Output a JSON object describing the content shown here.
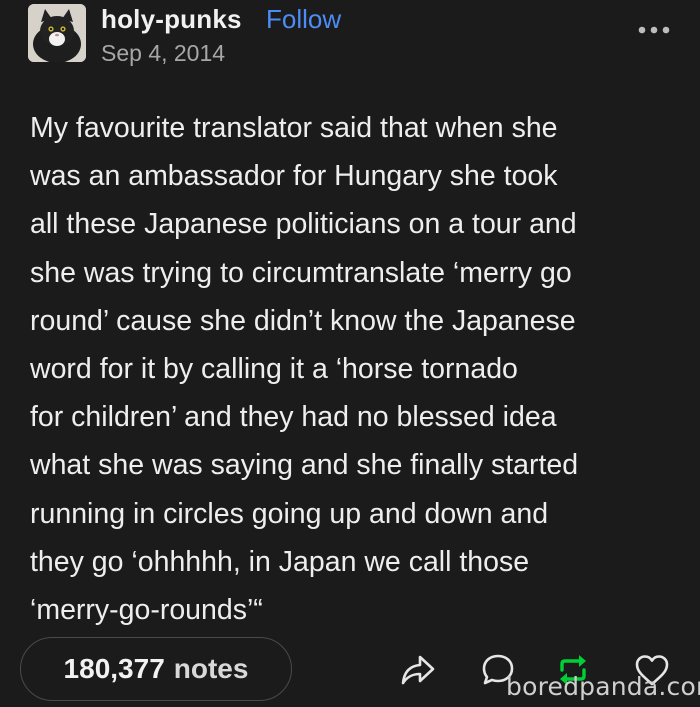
{
  "post": {
    "username": "holy-punks",
    "follow_label": "Follow",
    "date": "Sep 4, 2014",
    "more_icon": "ellipsis-icon",
    "body": "My favourite translator said that when she\nwas an ambassador for Hungary she took\nall these Japanese politicians on a tour and\nshe was trying to circumtranslate ‘merry go\nround’ cause she didn’t know the Japanese\nword for it by calling it a ‘horse tornado\nfor children’ and they had no blessed idea\nwhat she was saying and she finally started\nrunning in circles going up and down and\nthey go ‘ohhhhh, in Japan we call those\n‘merry-go-rounds’“"
  },
  "footer": {
    "notes_count": "180,377",
    "notes_label": "notes",
    "actions": [
      "share-icon",
      "reply-icon",
      "reblog-icon",
      "like-icon"
    ],
    "accent_color": "#00cf35",
    "link_color": "#4c8cf5"
  },
  "watermark": {
    "text": "boredpanda.com"
  }
}
